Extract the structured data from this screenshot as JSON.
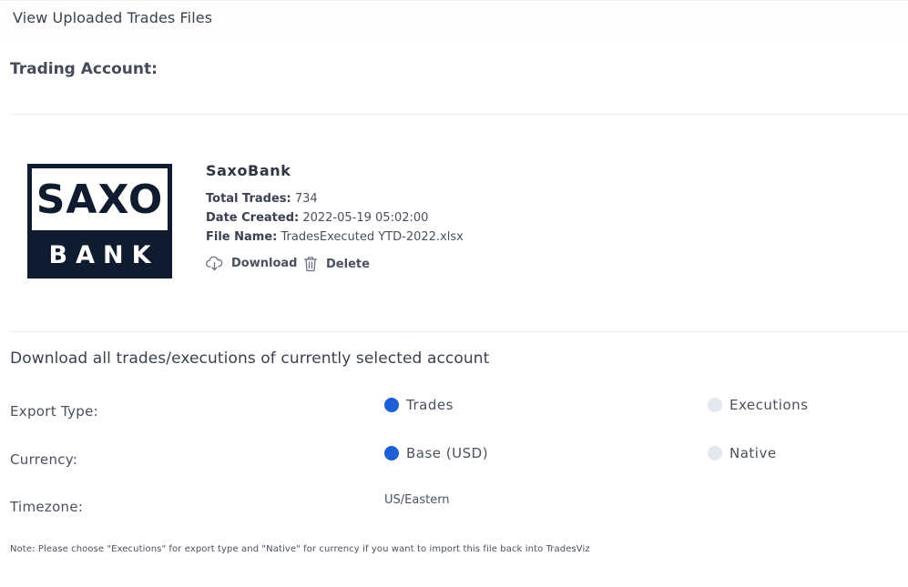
{
  "header": {
    "title": "View Uploaded Trades Files"
  },
  "account_section": {
    "title": "Trading Account:"
  },
  "file": {
    "logo": {
      "top_text": "SAXO",
      "bottom_text": "BANK"
    },
    "broker_name": "SaxoBank",
    "total_trades_label": "Total Trades:",
    "total_trades_value": "734",
    "date_created_label": "Date Created:",
    "date_created_value": "2022-05-19 05:02:00",
    "file_name_label": "File Name:",
    "file_name_value": "TradesExecuted YTD-2022.xlsx",
    "download_label": "Download",
    "delete_label": "Delete"
  },
  "export": {
    "title": "Download all trades/executions of currently selected account",
    "export_type": {
      "label": "Export Type:",
      "options": [
        {
          "label": "Trades",
          "selected": true
        },
        {
          "label": "Executions",
          "selected": false
        }
      ]
    },
    "currency": {
      "label": "Currency:",
      "options": [
        {
          "label": "Base (USD)",
          "selected": true
        },
        {
          "label": "Native",
          "selected": false
        }
      ]
    },
    "timezone": {
      "label": "Timezone:",
      "value": "US/Eastern"
    },
    "note": "Note: Please choose \"Executions\" for export type and \"Native\" for currency if you want to import this file back into TradesViz"
  },
  "colors": {
    "accent": "#1f5fd6",
    "radio_off": "#e3e8ef",
    "logo_navy": "#0f1b2e"
  },
  "icons": {
    "download": "cloud-download-icon",
    "delete": "trash-icon"
  }
}
